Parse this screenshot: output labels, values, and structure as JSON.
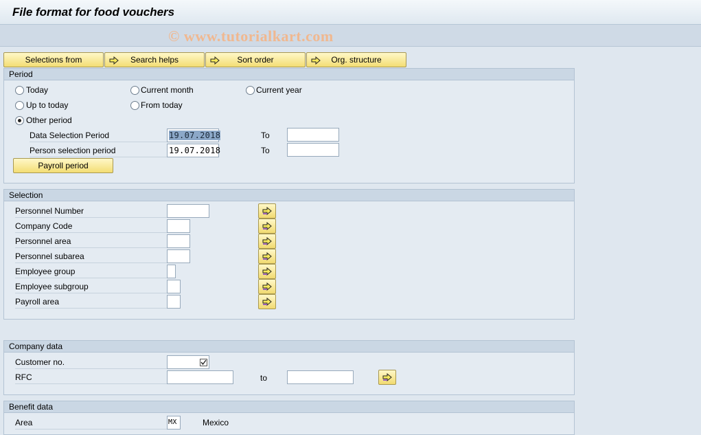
{
  "window": {
    "title": "File format for food vouchers"
  },
  "watermark": "© www.tutorialkart.com",
  "toolbar": {
    "buttons": [
      {
        "label": "Selections from"
      },
      {
        "label": "Search helps"
      },
      {
        "label": "Sort order"
      },
      {
        "label": "Org. structure"
      }
    ]
  },
  "period": {
    "title": "Period",
    "radios": {
      "today": "Today",
      "current_month": "Current month",
      "current_year": "Current year",
      "up_to_today": "Up to today",
      "from_today": "From today",
      "other_period": "Other period"
    },
    "data_selection": {
      "label": "Data Selection Period",
      "from": "19.07.2018",
      "to_label": "To",
      "to": ""
    },
    "person_selection": {
      "label": "Person selection period",
      "from": "19.07.2018",
      "to_label": "To",
      "to": ""
    },
    "payroll_button": "Payroll period"
  },
  "selection": {
    "title": "Selection",
    "rows": [
      {
        "label": "Personnel Number",
        "value": ""
      },
      {
        "label": "Company Code",
        "value": ""
      },
      {
        "label": "Personnel area",
        "value": ""
      },
      {
        "label": "Personnel subarea",
        "value": ""
      },
      {
        "label": "Employee group",
        "value": ""
      },
      {
        "label": "Employee subgroup",
        "value": ""
      },
      {
        "label": "Payroll area",
        "value": ""
      }
    ]
  },
  "company": {
    "title": "Company data",
    "customer": {
      "label": "Customer no.",
      "value": ""
    },
    "rfc": {
      "label": "RFC",
      "from": "",
      "to_label": "to",
      "to": ""
    }
  },
  "benefit": {
    "title": "Benefit data",
    "area": {
      "label": "Area",
      "value": "MX",
      "desc": "Mexico"
    }
  },
  "colors": {
    "accent": "#f3dd74",
    "group_header": "#cad7e4",
    "background": "#dfe7ef"
  }
}
